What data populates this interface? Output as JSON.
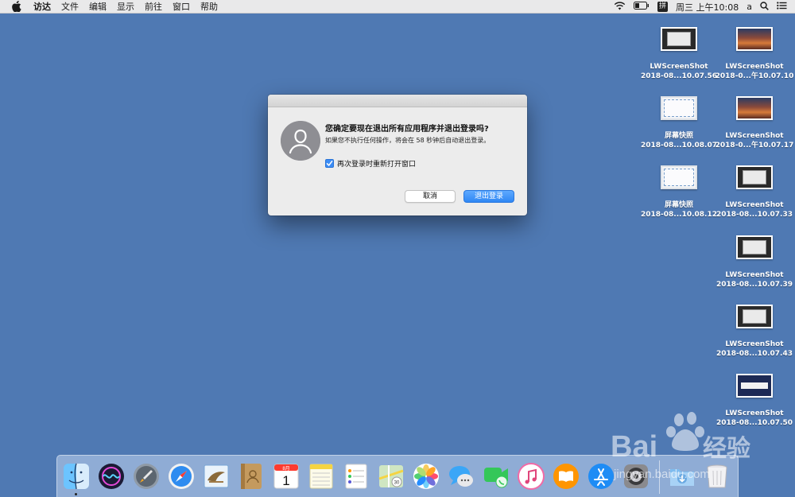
{
  "menubar": {
    "app_name": "访达",
    "items": [
      "文件",
      "编辑",
      "显示",
      "前往",
      "窗口",
      "帮助"
    ],
    "ime": "拼",
    "clock": "周三 上午10:08",
    "user_initial": "a"
  },
  "desktop": {
    "icons": [
      {
        "line1": "LWScreenShot",
        "line2": "2018-08...10.07.56",
        "thumb": "dark"
      },
      {
        "line1": "LWScreenShot",
        "line2": "2018-0...午10.07.10",
        "thumb": "sunset"
      },
      {
        "line1": "屏幕快照",
        "line2": "2018-08...10.08.07",
        "thumb": "light"
      },
      {
        "line1": "LWScreenShot",
        "line2": "2018-0...午10.07.17",
        "thumb": "sunset"
      },
      {
        "line1": "屏幕快照",
        "line2": "2018-08...10.08.12",
        "thumb": "light"
      },
      {
        "line1": "LWScreenShot",
        "line2": "2018-08...10.07.33",
        "thumb": "dark"
      },
      {
        "line1": "LWScreenShot",
        "line2": "2018-08...10.07.39",
        "thumb": "dark"
      },
      {
        "line1": "LWScreenShot",
        "line2": "2018-08...10.07.43",
        "thumb": "dark"
      },
      {
        "line1": "LWScreenShot",
        "line2": "2018-08...10.07.50",
        "thumb": "blue"
      }
    ]
  },
  "dialog": {
    "title": "您确定要现在退出所有应用程序并退出登录吗?",
    "message": "如果您不执行任何操作，将会在 58 秒钟后自动退出登录。",
    "checkbox_label": "再次登录时重新打开窗口",
    "checkbox_checked": true,
    "cancel_label": "取消",
    "logout_label": "退出登录"
  },
  "dock": {
    "calendar_month": "8月",
    "calendar_day": "1",
    "maps_badge": "30"
  },
  "watermark": {
    "brand": "Bai",
    "brand_tail": "经验",
    "url": "jingyan.baidu.com"
  },
  "colors": {
    "desktop": "#4f79b3",
    "accent": "#2f87f4"
  }
}
